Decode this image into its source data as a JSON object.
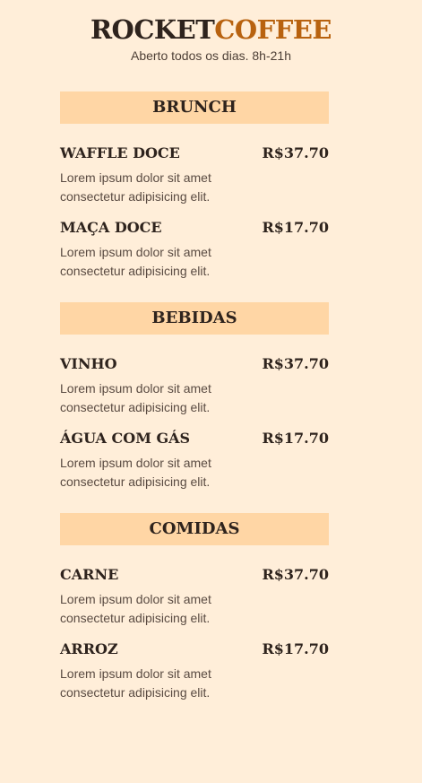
{
  "header": {
    "brand_dark": "ROCKET",
    "brand_accent": "COFFEE",
    "hours": "Aberto todos os dias. 8h-21h"
  },
  "colors": {
    "background": "#ffeed9",
    "section_bar": "#ffd6a5",
    "accent": "#b8620f",
    "text_dark": "#2e231d"
  },
  "sections": [
    {
      "title": "BRUNCH",
      "items": [
        {
          "name": "WAFFLE DOCE",
          "price": "R$37.70",
          "desc": "Lorem ipsum dolor sit amet consectetur adipisicing elit."
        },
        {
          "name": "MAÇA DOCE",
          "price": "R$17.70",
          "desc": "Lorem ipsum dolor sit amet consectetur adipisicing elit."
        }
      ]
    },
    {
      "title": "BEBIDAS",
      "items": [
        {
          "name": "VINHO",
          "price": "R$37.70",
          "desc": "Lorem ipsum dolor sit amet consectetur adipisicing elit."
        },
        {
          "name": "ÁGUA COM GÁS",
          "price": "R$17.70",
          "desc": "Lorem ipsum dolor sit amet consectetur adipisicing elit."
        }
      ]
    },
    {
      "title": "COMIDAS",
      "items": [
        {
          "name": "CARNE",
          "price": "R$37.70",
          "desc": "Lorem ipsum dolor sit amet consectetur adipisicing elit."
        },
        {
          "name": "ARROZ",
          "price": "R$17.70",
          "desc": "Lorem ipsum dolor sit amet consectetur adipisicing elit."
        }
      ]
    }
  ]
}
